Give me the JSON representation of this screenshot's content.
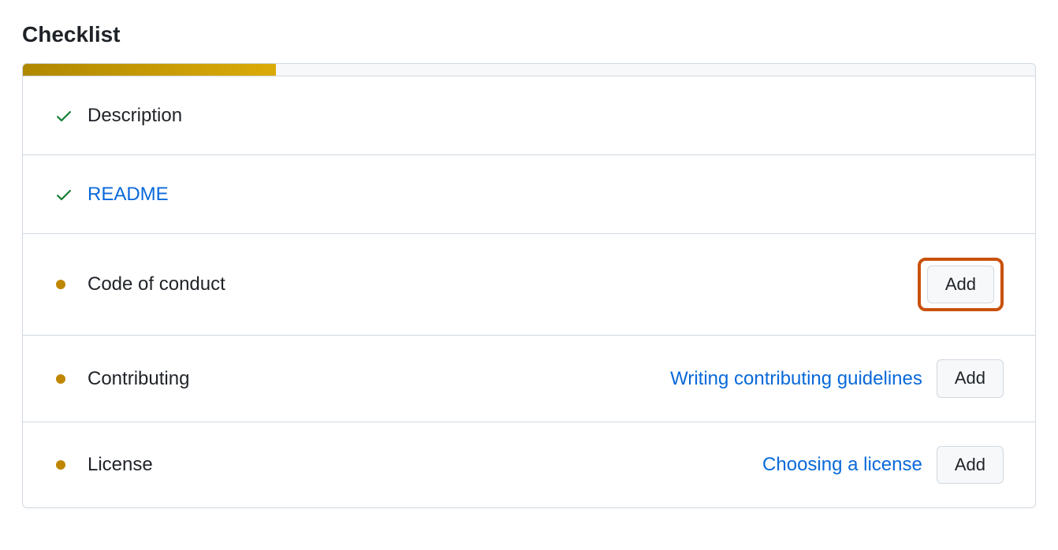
{
  "heading": "Checklist",
  "progress_percent": 25,
  "items": [
    {
      "label": "Description",
      "status": "done",
      "is_link": false
    },
    {
      "label": "README",
      "status": "done",
      "is_link": true
    },
    {
      "label": "Code of conduct",
      "status": "pending",
      "is_link": false,
      "add_label": "Add",
      "highlighted": true
    },
    {
      "label": "Contributing",
      "status": "pending",
      "is_link": false,
      "help_text": "Writing contributing guidelines",
      "add_label": "Add"
    },
    {
      "label": "License",
      "status": "pending",
      "is_link": false,
      "help_text": "Choosing a license",
      "add_label": "Add"
    }
  ]
}
